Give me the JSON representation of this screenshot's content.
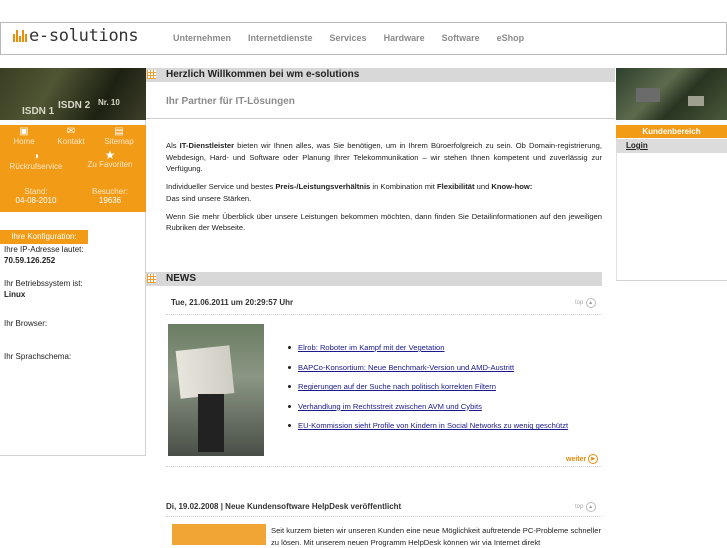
{
  "logo": {
    "text": "e-solutions"
  },
  "nav": [
    "Unternehmen",
    "Internetdienste",
    "Services",
    "Hardware",
    "Software",
    "eShop"
  ],
  "banner": {
    "labels": [
      "ISDN 1",
      "ISDN 2",
      "Nr. 10"
    ]
  },
  "quicklinks": [
    {
      "label": "Home",
      "icon": "home-icon"
    },
    {
      "label": "Kontakt",
      "icon": "mail-icon"
    },
    {
      "label": "Sitemap",
      "icon": "sitemap-icon"
    },
    {
      "label": "Rückrufservice",
      "icon": "callback-icon"
    },
    {
      "label": "Zu Favoriten",
      "icon": "star-icon"
    }
  ],
  "stand": {
    "label": "Stand:",
    "value": "04-08-2010"
  },
  "besucher": {
    "label": "Besucher:",
    "value": "19636"
  },
  "konfig": {
    "title": "Ihre Konfiguration:",
    "ip_label": "Ihre IP-Adresse lautet:",
    "ip_value": "70.59.126.252",
    "os_label": "Ihr Betriebssystem ist:",
    "os_value": "Linux",
    "browser_label": "Ihr Browser:",
    "lang_label": "Ihr Sprachschema:"
  },
  "welcome": {
    "title": "Herzlich Willkommen bei wm e-solutions",
    "subtitle": "Ihr Partner für IT-Lösungen"
  },
  "intro": {
    "p1_pre": "Als ",
    "p1_bold": "IT-Dienstleister",
    "p1_post": " bieten wir Ihnen alles, was Sie benötigen, um in Ihrem Büroerfolgreich zu sein. Ob Domain-registrierung, Webdesign, Hard- und Software oder Planung Ihrer Telekommunikation – wir stehen Ihnen kompetent und zuverlässig zur Verfügung.",
    "p2_a": "Individueller Service und bestes ",
    "p2_b": "Preis-/Leistungsverhältnis",
    "p2_c": " in Kombination mit ",
    "p2_d": "Flexibilität",
    "p2_e": " und ",
    "p2_f": "Know-how:",
    "p2_line2": "Das sind unsere Stärken.",
    "p3": "Wenn Sie mehr Überblick über unsere Leistungen bekommen möchten, dann finden Sie Detailinformationen auf den jeweiligen Rubriken der Webseite."
  },
  "news": {
    "title": "NEWS",
    "top_label": "top",
    "date1": "Tue, 21.06.2011 um 20:29:57 Uhr",
    "items": [
      "Elrob: Roboter im Kampf mit der Vegetation",
      "BAPCo-Konsortium: Neue Benchmark-Version und AMD-Austritt",
      "Regierungen auf der Suche nach politisch korrekten Filtern",
      "Verhandlung im Rechtsstreit zwischen AVM und Cybits",
      "EU-Kommission sieht Profile von Kindern in Social Networks zu wenig geschützt"
    ],
    "weiter": "weiter",
    "date2": "Di, 19.02.2008 | Neue Kundensoftware  HelpDesk veröffentlicht",
    "software_text": "Seit kurzem bieten wir unseren Kunden eine neue Möglichkeit auftretende PC-Probleme schneller zu lösen. Mit unserem neuen Programm HelpDesk können wir via Internet direkt"
  },
  "right": {
    "kunden_title": "Kundenbereich",
    "login": "Login"
  },
  "colors": {
    "accent": "#f29b17",
    "gray_bar": "#d8d8d8"
  }
}
